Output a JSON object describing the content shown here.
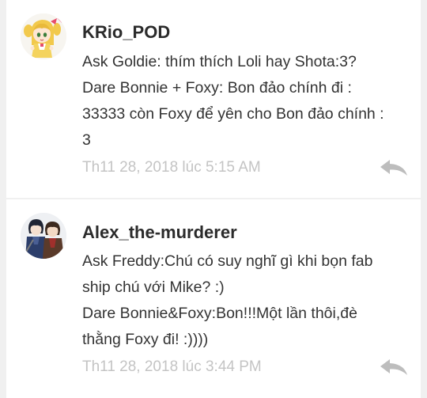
{
  "comments": [
    {
      "username": "KRio_POD",
      "lines": [
        "Ask Goldie: thím thích Loli hay Shota:3?",
        "Dare Bonnie + Foxy: Bon đảo chính đi :",
        "33333 còn Foxy để yên cho Bon đảo chính :",
        "3"
      ],
      "timestamp": "Th11 28, 2018 lúc 5:15 AM",
      "avatar_icon": "chibi-girl-avatar",
      "reply_icon": "reply-arrow-icon"
    },
    {
      "username": "Alex_the-murderer",
      "lines": [
        "Ask Freddy:Chú có suy nghĩ gì khi bọn fab",
        "ship chú với Mike? :)",
        "Dare Bonnie&Foxy:Bon!!!Một lần thôi,đè",
        "thằng Foxy đi! :))))"
      ],
      "timestamp": "Th11 28, 2018 lúc 3:44 PM",
      "avatar_icon": "two-characters-avatar",
      "reply_icon": "reply-arrow-icon"
    }
  ],
  "colors": {
    "background": "#f0f0f0",
    "card": "#ffffff",
    "username": "#2b2b2b",
    "body_text": "#333333",
    "timestamp": "#c4c4c4",
    "reply_icon": "#bdbdbd"
  }
}
